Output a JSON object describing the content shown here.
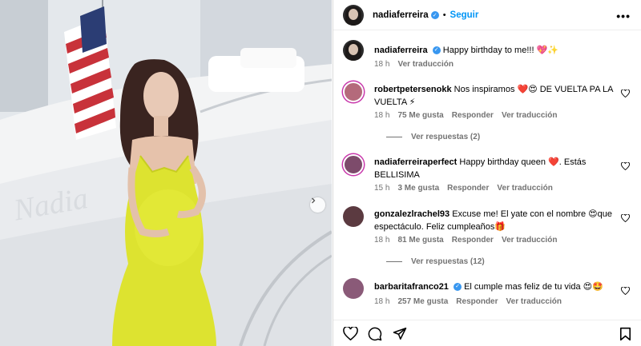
{
  "post": {
    "username": "nadiaferreira",
    "follow_label": "Seguir",
    "separator": "•"
  },
  "caption": {
    "username": "nadiaferreira",
    "text": "Happy birthday to me!!! 💖✨",
    "time": "18 h",
    "translate": "Ver traducción"
  },
  "comments": [
    {
      "username": "robertpetersenokk",
      "text": "Nos inspiramos ❤️😍 DE VUELTA PA LA VUELTA ⚡",
      "time": "18 h",
      "likes": "75 Me gusta",
      "reply": "Responder",
      "translate": "Ver traducción",
      "replies": "Ver respuestas (2)"
    },
    {
      "username": "nadiaferreiraperfect",
      "text": "Happy birthday queen ❤️. Estás BELLISIMA",
      "time": "15 h",
      "likes": "3 Me gusta",
      "reply": "Responder",
      "translate": "Ver traducción"
    },
    {
      "username": "gonzalezlrachel93",
      "text": "Excuse me! El yate con el nombre 😍que espectáculo. Feliz cumpleaños🎁",
      "time": "18 h",
      "likes": "81 Me gusta",
      "reply": "Responder",
      "translate": "Ver traducción",
      "replies": "Ver respuestas (12)"
    },
    {
      "username": "barbaritafranco21",
      "text": "El cumple mas feliz de tu vida 😍🤩",
      "time": "18 h",
      "likes": "257 Me gusta",
      "reply": "Responder",
      "translate": "Ver traducción"
    }
  ],
  "photo": {
    "hull_text": "Nadia"
  },
  "icons": {
    "more": "more-options-icon",
    "like": "heart-icon",
    "comment": "comment-icon",
    "share": "share-icon",
    "save": "bookmark-icon",
    "next": "chevron-right-icon"
  },
  "colors": {
    "accent": "#0095f6",
    "verified": "#3897f0",
    "dress": "#dde330",
    "muted": "#737373"
  }
}
